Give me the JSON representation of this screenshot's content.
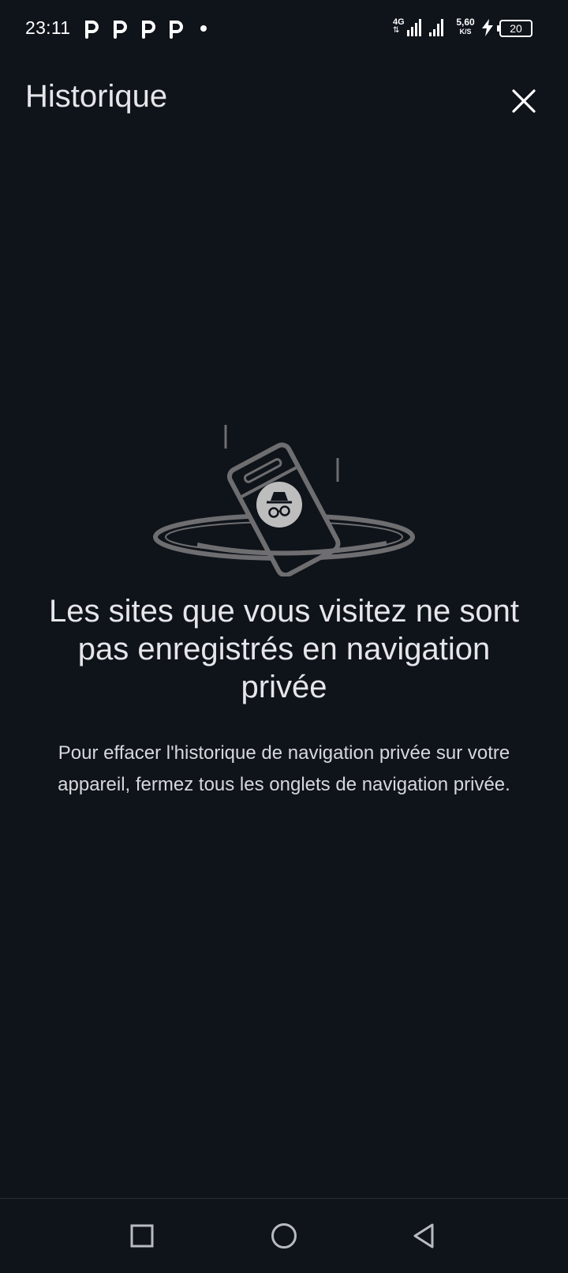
{
  "status_bar": {
    "time": "23:11",
    "network_type": "4G",
    "network_arrows": "⇅",
    "speed_value": "5,60",
    "speed_unit": "K/S",
    "battery_level": "20",
    "notification_icons": [
      "p-icon",
      "p-icon",
      "p-icon",
      "p-icon",
      "dot-icon"
    ]
  },
  "header": {
    "title": "Historique",
    "close_icon": "close-icon"
  },
  "empty_state": {
    "illustration": "incognito-phone-falling-in-hole",
    "title": "Les sites que vous visitez ne sont pas enregistrés en navigation privée",
    "description": "Pour effacer l'historique de navigation privée sur votre appareil, fermez tous les onglets de navigation privée."
  },
  "nav_bar": {
    "buttons": [
      "recents-square-icon",
      "home-circle-icon",
      "back-triangle-icon"
    ]
  },
  "colors": {
    "background": "#0f131a",
    "text_primary": "#e6e6ea",
    "text_secondary": "#d7d8dc",
    "illustration_gray": "#6e6e70",
    "badge_gray": "#bdbdbd"
  }
}
